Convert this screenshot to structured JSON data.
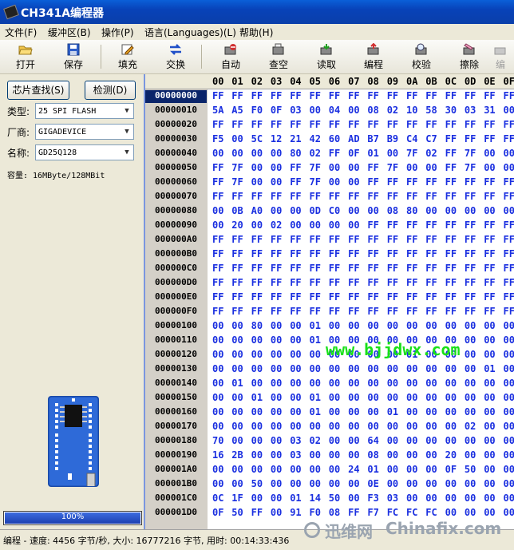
{
  "window": {
    "title": "CH341A编程器"
  },
  "menu": [
    "文件(F)",
    "缓冲区(B)",
    "操作(P)",
    "语言(Languages)(L)",
    "帮助(H)"
  ],
  "toolbar": {
    "open": "打开",
    "save": "保存",
    "fill": "填充",
    "swap": "交换",
    "auto": "自动",
    "blank": "查空",
    "read": "读取",
    "program": "编程",
    "verify": "校验",
    "erase": "擦除",
    "more": "编"
  },
  "left": {
    "find_button": "芯片查找(S)",
    "detect_button": "检测(D)",
    "type_label": "类型:",
    "type_value": "25 SPI FLASH",
    "vendor_label": "厂商:",
    "vendor_value": "GIGADEVICE",
    "name_label": "名称:",
    "name_value": "GD25Q128",
    "capacity": "容量: 16MByte/128MBit",
    "progress_text": "100%",
    "progress": 1.0
  },
  "hex": {
    "columns": [
      "00",
      "01",
      "02",
      "03",
      "04",
      "05",
      "06",
      "07",
      "08",
      "09",
      "0A",
      "0B",
      "0C",
      "0D",
      "0E",
      "0F"
    ],
    "rows": [
      {
        "addr": "00000000",
        "bytes": [
          "FF",
          "FF",
          "FF",
          "FF",
          "FF",
          "FF",
          "FF",
          "FF",
          "FF",
          "FF",
          "FF",
          "FF",
          "FF",
          "FF",
          "FF",
          "FF"
        ]
      },
      {
        "addr": "00000010",
        "bytes": [
          "5A",
          "A5",
          "F0",
          "0F",
          "03",
          "00",
          "04",
          "00",
          "08",
          "02",
          "10",
          "58",
          "30",
          "03",
          "31",
          "00"
        ]
      },
      {
        "addr": "00000020",
        "bytes": [
          "FF",
          "FF",
          "FF",
          "FF",
          "FF",
          "FF",
          "FF",
          "FF",
          "FF",
          "FF",
          "FF",
          "FF",
          "FF",
          "FF",
          "FF",
          "FF"
        ]
      },
      {
        "addr": "00000030",
        "bytes": [
          "F5",
          "00",
          "5C",
          "12",
          "21",
          "42",
          "60",
          "AD",
          "B7",
          "B9",
          "C4",
          "C7",
          "FF",
          "FF",
          "FF",
          "FF"
        ]
      },
      {
        "addr": "00000040",
        "bytes": [
          "00",
          "00",
          "00",
          "00",
          "80",
          "02",
          "FF",
          "0F",
          "01",
          "00",
          "7F",
          "02",
          "FF",
          "7F",
          "00",
          "00"
        ]
      },
      {
        "addr": "00000050",
        "bytes": [
          "FF",
          "7F",
          "00",
          "00",
          "FF",
          "7F",
          "00",
          "00",
          "FF",
          "7F",
          "00",
          "00",
          "FF",
          "7F",
          "00",
          "00"
        ]
      },
      {
        "addr": "00000060",
        "bytes": [
          "FF",
          "7F",
          "00",
          "00",
          "FF",
          "7F",
          "00",
          "00",
          "FF",
          "FF",
          "FF",
          "FF",
          "FF",
          "FF",
          "FF",
          "FF"
        ]
      },
      {
        "addr": "00000070",
        "bytes": [
          "FF",
          "FF",
          "FF",
          "FF",
          "FF",
          "FF",
          "FF",
          "FF",
          "FF",
          "FF",
          "FF",
          "FF",
          "FF",
          "FF",
          "FF",
          "FF"
        ]
      },
      {
        "addr": "00000080",
        "bytes": [
          "00",
          "0B",
          "A0",
          "00",
          "00",
          "0D",
          "C0",
          "00",
          "00",
          "08",
          "80",
          "00",
          "00",
          "00",
          "00",
          "00"
        ]
      },
      {
        "addr": "00000090",
        "bytes": [
          "00",
          "20",
          "00",
          "02",
          "00",
          "00",
          "00",
          "00",
          "FF",
          "FF",
          "FF",
          "FF",
          "FF",
          "FF",
          "FF",
          "FF"
        ]
      },
      {
        "addr": "000000A0",
        "bytes": [
          "FF",
          "FF",
          "FF",
          "FF",
          "FF",
          "FF",
          "FF",
          "FF",
          "FF",
          "FF",
          "FF",
          "FF",
          "FF",
          "FF",
          "FF",
          "FF"
        ]
      },
      {
        "addr": "000000B0",
        "bytes": [
          "FF",
          "FF",
          "FF",
          "FF",
          "FF",
          "FF",
          "FF",
          "FF",
          "FF",
          "FF",
          "FF",
          "FF",
          "FF",
          "FF",
          "FF",
          "FF"
        ]
      },
      {
        "addr": "000000C0",
        "bytes": [
          "FF",
          "FF",
          "FF",
          "FF",
          "FF",
          "FF",
          "FF",
          "FF",
          "FF",
          "FF",
          "FF",
          "FF",
          "FF",
          "FF",
          "FF",
          "FF"
        ]
      },
      {
        "addr": "000000D0",
        "bytes": [
          "FF",
          "FF",
          "FF",
          "FF",
          "FF",
          "FF",
          "FF",
          "FF",
          "FF",
          "FF",
          "FF",
          "FF",
          "FF",
          "FF",
          "FF",
          "FF"
        ]
      },
      {
        "addr": "000000E0",
        "bytes": [
          "FF",
          "FF",
          "FF",
          "FF",
          "FF",
          "FF",
          "FF",
          "FF",
          "FF",
          "FF",
          "FF",
          "FF",
          "FF",
          "FF",
          "FF",
          "FF"
        ]
      },
      {
        "addr": "000000F0",
        "bytes": [
          "FF",
          "FF",
          "FF",
          "FF",
          "FF",
          "FF",
          "FF",
          "FF",
          "FF",
          "FF",
          "FF",
          "FF",
          "FF",
          "FF",
          "FF",
          "FF"
        ]
      },
      {
        "addr": "00000100",
        "bytes": [
          "00",
          "00",
          "80",
          "00",
          "00",
          "01",
          "00",
          "00",
          "00",
          "00",
          "00",
          "00",
          "00",
          "00",
          "00",
          "00"
        ]
      },
      {
        "addr": "00000110",
        "bytes": [
          "00",
          "00",
          "00",
          "00",
          "00",
          "01",
          "00",
          "00",
          "00",
          "00",
          "00",
          "00",
          "00",
          "00",
          "00",
          "00"
        ]
      },
      {
        "addr": "00000120",
        "bytes": [
          "00",
          "00",
          "00",
          "00",
          "00",
          "00",
          "00",
          "00",
          "00",
          "00",
          "01",
          "00",
          "00",
          "00",
          "00",
          "00"
        ]
      },
      {
        "addr": "00000130",
        "bytes": [
          "00",
          "00",
          "00",
          "00",
          "00",
          "00",
          "00",
          "00",
          "00",
          "00",
          "00",
          "00",
          "00",
          "00",
          "01",
          "00"
        ]
      },
      {
        "addr": "00000140",
        "bytes": [
          "00",
          "01",
          "00",
          "00",
          "00",
          "00",
          "00",
          "00",
          "00",
          "00",
          "00",
          "00",
          "00",
          "00",
          "00",
          "00"
        ]
      },
      {
        "addr": "00000150",
        "bytes": [
          "00",
          "00",
          "01",
          "00",
          "00",
          "01",
          "00",
          "00",
          "00",
          "00",
          "00",
          "00",
          "00",
          "00",
          "00",
          "00"
        ]
      },
      {
        "addr": "00000160",
        "bytes": [
          "00",
          "00",
          "00",
          "00",
          "00",
          "01",
          "00",
          "00",
          "00",
          "01",
          "00",
          "00",
          "00",
          "00",
          "00",
          "00"
        ]
      },
      {
        "addr": "00000170",
        "bytes": [
          "00",
          "00",
          "00",
          "00",
          "00",
          "00",
          "00",
          "00",
          "00",
          "00",
          "00",
          "00",
          "00",
          "02",
          "00",
          "00"
        ]
      },
      {
        "addr": "00000180",
        "bytes": [
          "70",
          "00",
          "00",
          "00",
          "03",
          "02",
          "00",
          "00",
          "64",
          "00",
          "00",
          "00",
          "00",
          "00",
          "00",
          "00"
        ]
      },
      {
        "addr": "00000190",
        "bytes": [
          "16",
          "2B",
          "00",
          "00",
          "03",
          "00",
          "00",
          "00",
          "08",
          "00",
          "00",
          "00",
          "20",
          "00",
          "00",
          "00"
        ]
      },
      {
        "addr": "000001A0",
        "bytes": [
          "00",
          "00",
          "00",
          "00",
          "00",
          "00",
          "00",
          "24",
          "01",
          "00",
          "00",
          "00",
          "0F",
          "50",
          "00",
          "00"
        ]
      },
      {
        "addr": "000001B0",
        "bytes": [
          "00",
          "00",
          "50",
          "00",
          "00",
          "00",
          "00",
          "00",
          "0E",
          "00",
          "00",
          "00",
          "00",
          "00",
          "00",
          "00"
        ]
      },
      {
        "addr": "000001C0",
        "bytes": [
          "0C",
          "1F",
          "00",
          "00",
          "01",
          "14",
          "50",
          "00",
          "F3",
          "03",
          "00",
          "00",
          "00",
          "00",
          "00",
          "00"
        ]
      },
      {
        "addr": "000001D0",
        "bytes": [
          "0F",
          "50",
          "FF",
          "00",
          "91",
          "F0",
          "08",
          "FF",
          "F7",
          "FC",
          "FC",
          "FC",
          "00",
          "00",
          "00",
          "00"
        ]
      }
    ]
  },
  "watermark": "www.bjjdwx.com",
  "status": "编程 - 速度: 4456 字节/秒, 大小: 16777216 字节, 用时: 00:14:33:436",
  "brand": {
    "cn": "迅维网",
    "en": "Chinafix.com"
  },
  "colors": {
    "title": "#0A4FC8",
    "hex_text": "#1A2FE0",
    "watermark": "#18E018",
    "selected_addr": "#0A246A"
  }
}
